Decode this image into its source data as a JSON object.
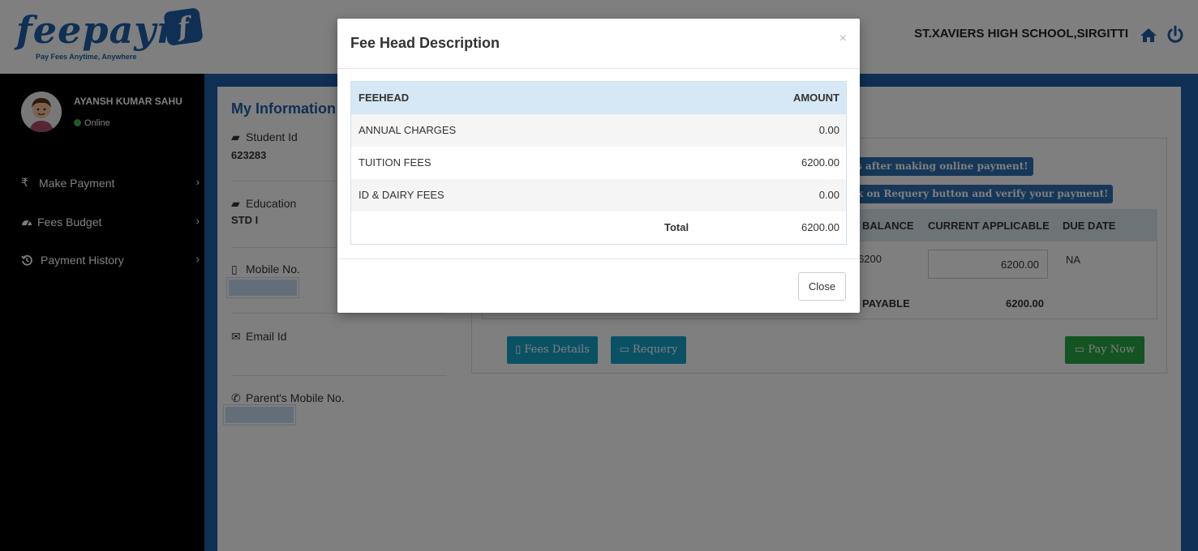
{
  "header": {
    "logo_text": "feepayr",
    "logo_badge": "f",
    "logo_tagline": "Pay Fees Anytime, Anywhere",
    "school_name": "ST.XAVIERS HIGH SCHOOL,SIRGITTI",
    "icons": [
      "home-icon",
      "power-icon"
    ]
  },
  "sidebar": {
    "user_name": "AYANSH KUMAR SAHU",
    "status": "Online",
    "items": [
      {
        "label": "Make Payment",
        "icon": "rupee-icon"
      },
      {
        "label": "Fees Budget",
        "icon": "dashboard-icon"
      },
      {
        "label": "Payment History",
        "icon": "history-icon"
      }
    ]
  },
  "info": {
    "title": "My Information",
    "student_id_label": "Student Id",
    "student_id": "623283",
    "education_label": "Education",
    "education": "STD I",
    "mobile_label": "Mobile No.",
    "email_label": "Email Id",
    "parent_mobile_label": "Parent's Mobile No."
  },
  "payment": {
    "alert1": "s after making online payment!",
    "alert2": "k on Requery button and verify your payment!",
    "col_balance": "BALANCE",
    "col_current": "CURRENT APPLICABLE",
    "col_due": "DUE DATE",
    "row_balance": "6200",
    "row_current": "6200.00",
    "row_due": "NA",
    "payable_label": "PAYABLE",
    "payable_amount": "6200.00",
    "btn_fees_details": "Fees Details",
    "btn_requery": "Requery",
    "btn_pay_now": "Pay Now"
  },
  "modal": {
    "title": "Fee Head Description",
    "close_x": "×",
    "col_feehead": "FEEHEAD",
    "col_amount": "AMOUNT",
    "rows": [
      {
        "head": "ANNUAL CHARGES",
        "amount": "0.00"
      },
      {
        "head": "TUITION FEES",
        "amount": "6200.00"
      },
      {
        "head": "ID & DAIRY FEES",
        "amount": "0.00"
      }
    ],
    "total_label": "Total",
    "total_amount": "6200.00",
    "close_button": "Close"
  },
  "colors": {
    "brand_blue": "#1e5fa8",
    "info_button": "#17a2c8",
    "success_button": "#28a745",
    "table_header": "#d6e8f5"
  }
}
